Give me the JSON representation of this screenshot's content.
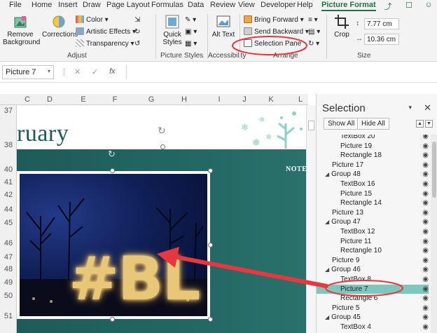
{
  "tabs": [
    "File",
    "Home",
    "Insert",
    "Draw",
    "Page Layout",
    "Formulas",
    "Data",
    "Review",
    "View",
    "Developer",
    "Help",
    "Picture Format"
  ],
  "active_tab": "Picture Format",
  "ribbon": {
    "remove_background": "Remove Background",
    "corrections": "Corrections",
    "color": "Color",
    "artistic_effects": "Artistic Effects",
    "transparency": "Transparency",
    "adjust_label": "Adjust",
    "quick_styles": "Quick Styles",
    "picture_styles_label": "Picture Styles",
    "alt_text": "Alt Text",
    "accessibility_label": "Accessibility",
    "bring_forward": "Bring Forward",
    "send_backward": "Send Backward",
    "selection_pane": "Selection Pane",
    "arrange_label": "Arrange",
    "crop": "Crop",
    "height": "7.77 cm",
    "width": "10.36 cm",
    "size_label": "Size"
  },
  "formula_bar": {
    "name_box": "Picture 7",
    "fx": "fx"
  },
  "sheet": {
    "columns": [
      "C",
      "D",
      "E",
      "F",
      "G",
      "H",
      "I",
      "J",
      "K",
      "L"
    ],
    "rows": [
      "37",
      "38",
      "40",
      "41",
      "42",
      "44",
      "45",
      "46",
      "47",
      "48",
      "49",
      "50",
      "51"
    ],
    "month_text": "ruary",
    "notes_text": "NOTE",
    "picture_text": "#BL"
  },
  "selection_pane": {
    "title": "Selection",
    "show_all": "Show All",
    "hide_all": "Hide All",
    "items": [
      {
        "label": "TextBox 20",
        "indent": 2,
        "group": false,
        "selected": false
      },
      {
        "label": "Picture 19",
        "indent": 2,
        "group": false,
        "selected": false
      },
      {
        "label": "Rectangle 18",
        "indent": 2,
        "group": false,
        "selected": false
      },
      {
        "label": "Picture 17",
        "indent": 1,
        "group": false,
        "selected": false
      },
      {
        "label": "Group 48",
        "indent": 1,
        "group": true,
        "selected": false
      },
      {
        "label": "TextBox 16",
        "indent": 2,
        "group": false,
        "selected": false
      },
      {
        "label": "Picture 15",
        "indent": 2,
        "group": false,
        "selected": false
      },
      {
        "label": "Rectangle 14",
        "indent": 2,
        "group": false,
        "selected": false
      },
      {
        "label": "Picture 13",
        "indent": 1,
        "group": false,
        "selected": false
      },
      {
        "label": "Group 47",
        "indent": 1,
        "group": true,
        "selected": false
      },
      {
        "label": "TextBox 12",
        "indent": 2,
        "group": false,
        "selected": false
      },
      {
        "label": "Picture 11",
        "indent": 2,
        "group": false,
        "selected": false
      },
      {
        "label": "Rectangle 10",
        "indent": 2,
        "group": false,
        "selected": false
      },
      {
        "label": "Picture 9",
        "indent": 1,
        "group": false,
        "selected": false
      },
      {
        "label": "Group 46",
        "indent": 1,
        "group": true,
        "selected": false
      },
      {
        "label": "TextBox 8",
        "indent": 2,
        "group": false,
        "selected": false
      },
      {
        "label": "Picture 7",
        "indent": 2,
        "group": false,
        "selected": true
      },
      {
        "label": "Rectangle 6",
        "indent": 2,
        "group": false,
        "selected": false
      },
      {
        "label": "Picture 5",
        "indent": 1,
        "group": false,
        "selected": false
      },
      {
        "label": "Group 45",
        "indent": 1,
        "group": true,
        "selected": false
      },
      {
        "label": "TextBox 4",
        "indent": 2,
        "group": false,
        "selected": false
      }
    ]
  },
  "colors": {
    "accent": "#217346",
    "annotation_red": "#e8373f",
    "teal": "#236763",
    "selected_row": "#7fc6bd"
  }
}
